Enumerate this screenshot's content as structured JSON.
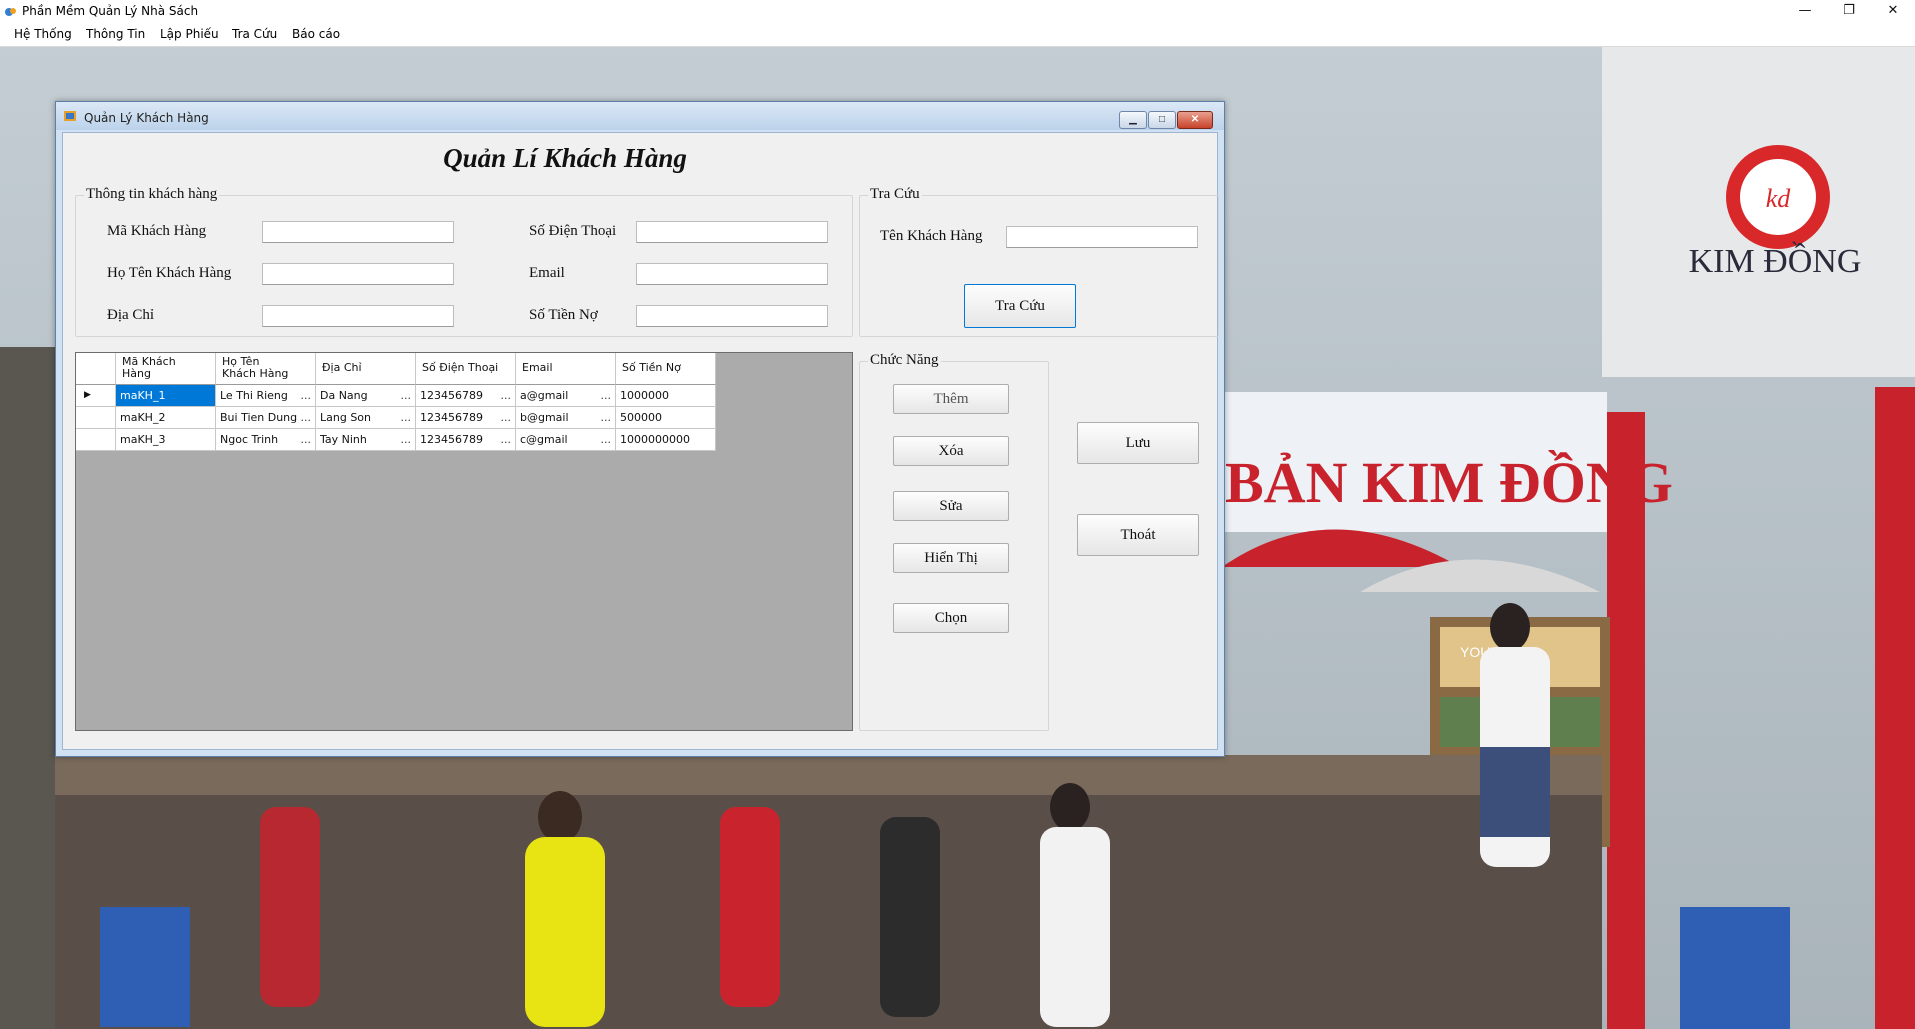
{
  "app": {
    "title": "Phần Mềm Quản Lý Nhà Sách",
    "controls": {
      "minimize": "—",
      "maximize": "❐",
      "close": "✕"
    }
  },
  "menu": {
    "items": [
      "Hệ Thống",
      "Thông Tin",
      "Lập Phiếu",
      "Tra Cứu",
      "Báo cáo"
    ]
  },
  "background_scene": {
    "sign_brand": "KIM ĐỒNG",
    "banner_text": "BẢN KIM ĐỒNG",
    "booth_text": "YOUTH"
  },
  "child_window": {
    "title": "Quản Lý Khách Hàng",
    "controls": {
      "minimize": "▁",
      "maximize": "□",
      "close": "✕"
    },
    "page_title": "Quản Lí Khách Hàng",
    "customer_info": {
      "legend": "Thông tin khách hàng",
      "fields": {
        "customer_id": {
          "label": "Mã Khách Hàng",
          "value": ""
        },
        "full_name": {
          "label": "Họ Tên Khách Hàng",
          "value": ""
        },
        "address": {
          "label": "Địa Chỉ",
          "value": ""
        },
        "phone": {
          "label": "Số Điện Thoại",
          "value": ""
        },
        "email": {
          "label": "Email",
          "value": ""
        },
        "debt": {
          "label": "Số Tiền Nợ",
          "value": ""
        }
      }
    },
    "search": {
      "legend": "Tra Cứu",
      "label": "Tên Khách Hàng",
      "value": "",
      "button": "Tra Cứu"
    },
    "functions": {
      "legend": "Chức Năng",
      "add": "Thêm",
      "delete": "Xóa",
      "edit": "Sửa",
      "show": "Hiển Thị",
      "select": "Chọn",
      "save": "Lưu",
      "exit": "Thoát"
    },
    "grid": {
      "columns": [
        "Mã Khách Hàng",
        "Họ Tên Khách Hàng",
        "Địa Chỉ",
        "Số Điện Thoại",
        "Email",
        "Số Tiền Nợ"
      ],
      "column_lines": [
        [
          "Mã Khách",
          "Hàng"
        ],
        [
          "Họ Tên",
          "Khách Hàng"
        ],
        [
          "Địa Chỉ"
        ],
        [
          "Số Điện Thoại"
        ],
        [
          "Email"
        ],
        [
          "Số Tiền Nợ"
        ]
      ],
      "row_indicator": "▶",
      "rows": [
        [
          "maKH_1",
          "Le Thi Rieng",
          "Da Nang",
          "123456789",
          "a@gmail",
          "1000000"
        ],
        [
          "maKH_2",
          "Bui Tien Dung",
          "Lang Son",
          "123456789",
          "b@gmail",
          "500000"
        ],
        [
          "maKH_3",
          "Ngoc Trinh",
          "Tay Ninh",
          "123456789",
          "c@gmail",
          "1000000000"
        ]
      ],
      "ellipsis": "..."
    }
  }
}
